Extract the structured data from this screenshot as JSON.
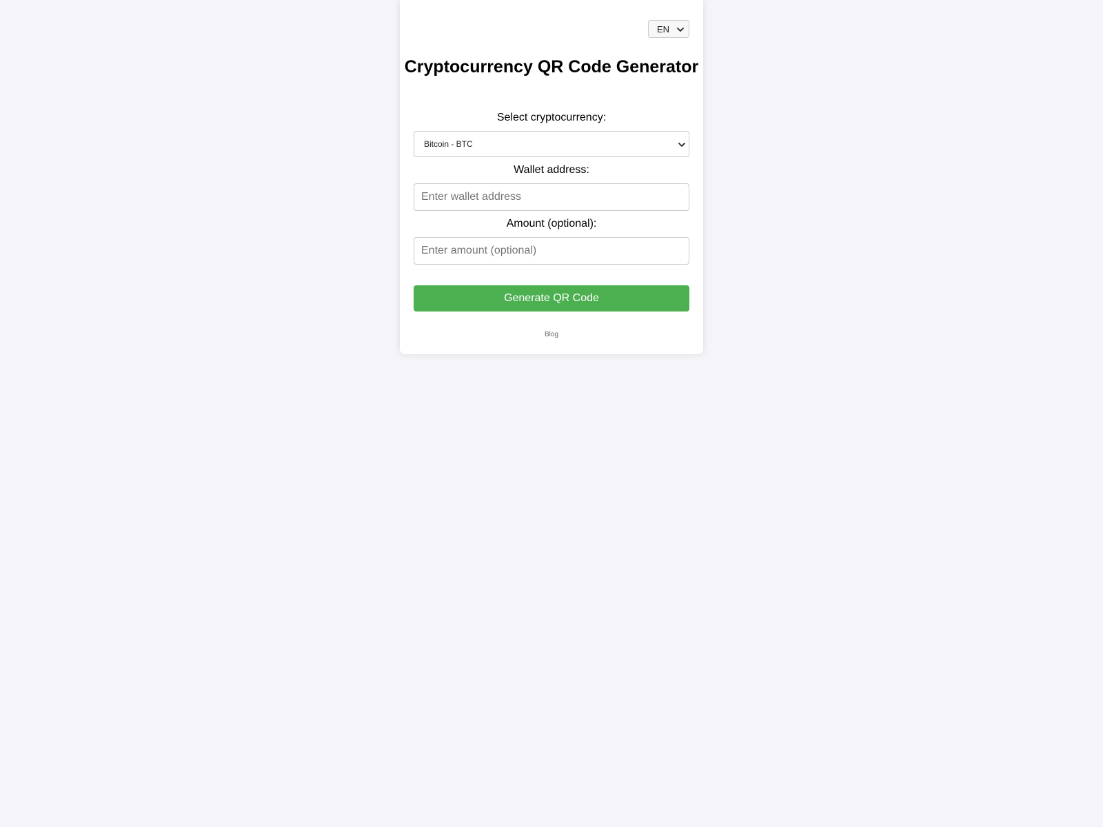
{
  "language": {
    "selected": "EN"
  },
  "page": {
    "title": "Cryptocurrency QR Code Generator"
  },
  "form": {
    "crypto_label": "Select cryptocurrency:",
    "crypto_selected": "Bitcoin - BTC",
    "wallet_label": "Wallet address:",
    "wallet_placeholder": "Enter wallet address",
    "wallet_value": "",
    "amount_label": "Amount (optional):",
    "amount_placeholder": "Enter amount (optional)",
    "amount_value": "",
    "generate_label": "Generate QR Code"
  },
  "footer": {
    "blog_label": "Blog"
  },
  "colors": {
    "page_background": "#f4f4f9",
    "card_background": "#ffffff",
    "button_green": "#4caf50"
  },
  "icons": {
    "language_dropdown": "chevron-down-icon",
    "crypto_dropdown": "chevron-down-icon"
  }
}
